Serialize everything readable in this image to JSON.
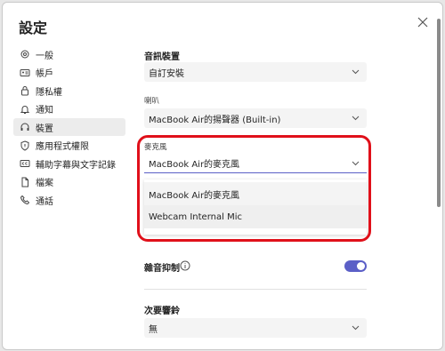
{
  "dialog": {
    "title": "設定"
  },
  "nav": {
    "items": [
      {
        "label": "一般",
        "icon": "gear-icon"
      },
      {
        "label": "帳戶",
        "icon": "id-card-icon"
      },
      {
        "label": "隱私權",
        "icon": "lock-icon"
      },
      {
        "label": "通知",
        "icon": "bell-icon"
      },
      {
        "label": "裝置",
        "icon": "headset-icon",
        "active": true
      },
      {
        "label": "應用程式權限",
        "icon": "shield-icon"
      },
      {
        "label": "輔助字幕與文字記錄",
        "icon": "cc-icon"
      },
      {
        "label": "檔案",
        "icon": "file-icon"
      },
      {
        "label": "通話",
        "icon": "phone-icon"
      }
    ]
  },
  "audio": {
    "title": "音訊裝置",
    "device_value": "自訂安裝",
    "speaker_label": "喇叭",
    "speaker_value": "MacBook Air的揚聲器 (Built-in)",
    "mic_label": "麥克風",
    "mic_value": "MacBook Air的麥克風",
    "mic_options": [
      "MacBook Air的麥克風",
      "Webcam Internal Mic"
    ]
  },
  "noise": {
    "label": "雜音抑制",
    "enabled": true
  },
  "secondary": {
    "title": "次要響鈴",
    "value": "無"
  },
  "colors": {
    "accent": "#5b5fc7",
    "highlight": "#e0101a"
  }
}
